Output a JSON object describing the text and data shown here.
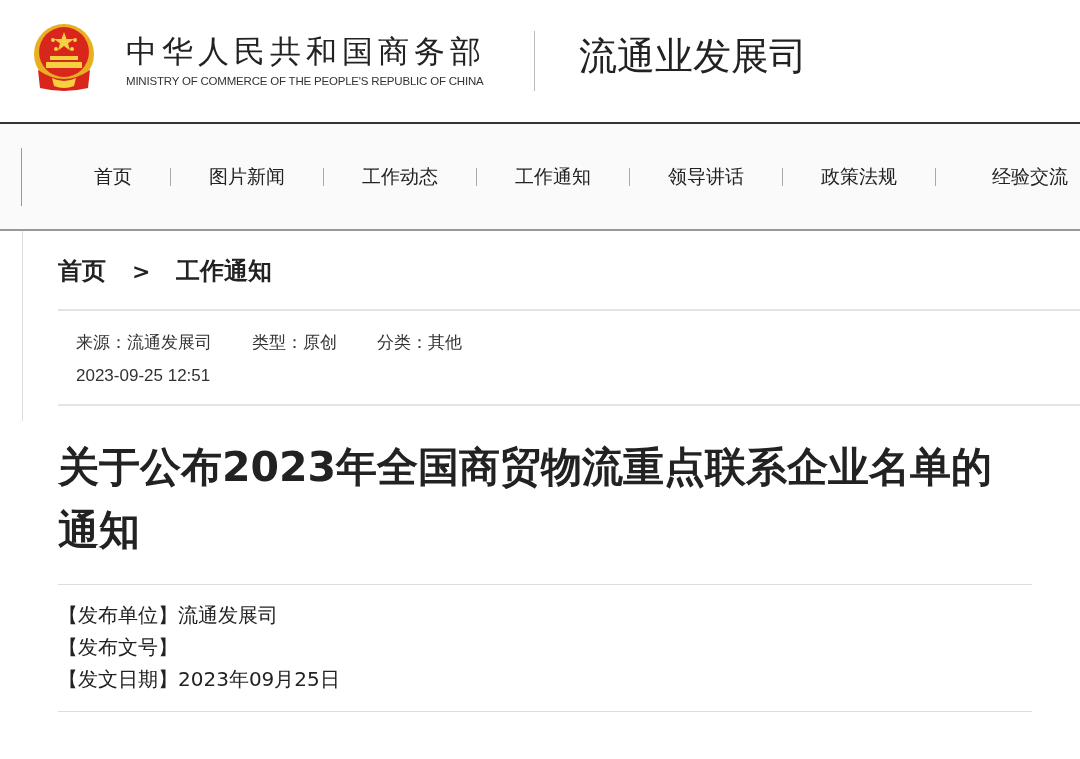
{
  "header": {
    "ministry_name": "中华人民共和国商务部",
    "ministry_name_en": "MINISTRY OF COMMERCE OF THE PEOPLE'S REPUBLIC OF CHINA",
    "department": "流通业发展司"
  },
  "nav": {
    "items": [
      {
        "label": "首页"
      },
      {
        "label": "图片新闻"
      },
      {
        "label": "工作动态"
      },
      {
        "label": "工作通知"
      },
      {
        "label": "领导讲话"
      },
      {
        "label": "政策法规"
      },
      {
        "label": "经验交流"
      }
    ]
  },
  "breadcrumb": {
    "items": [
      "首页",
      "工作通知"
    ],
    "separator": ">"
  },
  "meta": {
    "fields": [
      {
        "label": "来源：",
        "value": "流通发展司"
      },
      {
        "label": "类型：",
        "value": "原创"
      },
      {
        "label": "分类：",
        "value": "其他"
      }
    ],
    "datetime": "2023-09-25 12:51"
  },
  "article": {
    "title": "关于公布2023年全国商贸物流重点联系企业名单的通知",
    "info": [
      {
        "label": "【发布单位】",
        "value": "流通发展司"
      },
      {
        "label": "【发布文号】"
      },
      {
        "label": "【发文日期】",
        "value": "2023年09月25日"
      }
    ]
  }
}
